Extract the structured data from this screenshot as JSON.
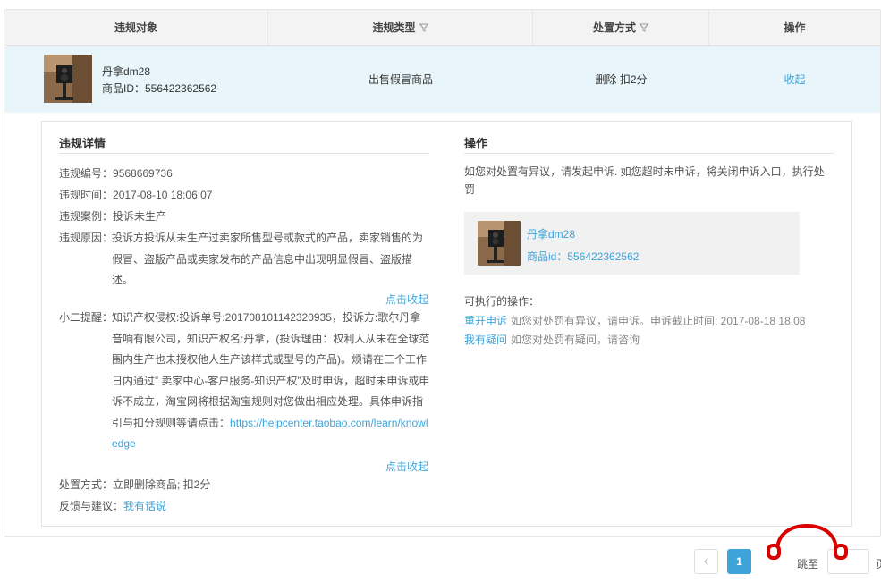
{
  "table": {
    "headers": [
      "违规对象",
      "违规类型",
      "处置方式",
      "操作"
    ]
  },
  "row": {
    "product_name": "丹拿dm28",
    "product_id": "商品ID：556422362562",
    "violation_type": "出售假冒商品",
    "disposal": "删除 扣2分",
    "operation": "收起"
  },
  "detail": {
    "title": "违规详情",
    "number_label": "违规编号：",
    "number": "9568669736",
    "time_label": "违规时间：",
    "time": "2017-08-10 18:06:07",
    "case_label": "违规案例：",
    "case": "投诉未生产",
    "reason_label": "违规原因：",
    "reason": "投诉方投诉从未生产过卖家所售型号或款式的产品，卖家销售的为假冒、盗版产品或卖家发布的产品信息中出现明显假冒、盗版描述。",
    "collapse_1": "点击收起",
    "tip_label": "小二提醒：",
    "tip_text": "知识产权侵权:投诉单号:201708101142320935，投诉方:歌尔丹拿音响有限公司，知识产权名:丹拿，(投诉理由：权利人从未在全球范围内生产也未授权他人生产该样式或型号的产品)。烦请在三个工作日内通过” 卖家中心-客户服务-知识产权”及时申诉，超时未申诉或申诉不成立，淘宝网将根据淘宝规则对您做出相应处理。具体申诉指引与扣分规则等请点击：",
    "tip_link": "https://helpcenter.taobao.com/learn/knowledge",
    "collapse_2": "点击收起",
    "disposal_label": "处置方式：",
    "disposal": "立即删除商品; 扣2分",
    "feedback_label": "反馈与建议：",
    "feedback_link": "我有话说"
  },
  "operation": {
    "title": "操作",
    "description": "如您对处置有异议，请发起申诉. 如您超时未申诉，将关闭申诉入口，执行处罚",
    "product_name": "丹拿dm28",
    "product_id": "商品id：556422362562",
    "available_label": "可执行的操作：",
    "appeal_link": "重开申诉",
    "appeal_desc": "如您对处罚有异议，请申诉。申诉截止时间: 2017-08-18 18:08",
    "question_link": "我有疑问",
    "question_desc": "如您对处罚有疑问，请咨询"
  },
  "pagination": {
    "current_page": "1",
    "jump_text": "跳至",
    "page_suffix": "页"
  },
  "colors": {
    "link": "#3da3d8",
    "row_highlight": "#e8f6fb",
    "header_bg": "#f3f3f3",
    "watermark": "#d90000"
  },
  "icons": {
    "filter": "filter-icon",
    "prev": "chevron-left-icon"
  }
}
